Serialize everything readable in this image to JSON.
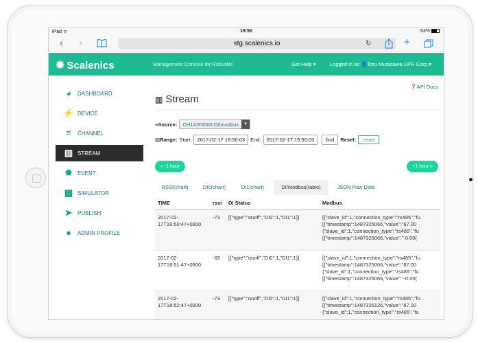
{
  "status_bar": {
    "carrier": "iPad ᯤ",
    "time": "19:50",
    "battery": "63%"
  },
  "browser": {
    "url": "stg.scalenics.io",
    "reload_icon": "reload-icon"
  },
  "header": {
    "logo": "Scalenics",
    "console_title": "Management Console for Robustel",
    "help": "Get Help ▾",
    "logged_in": "Logged in as:👤Toru Murasawa UPR Corp.▾"
  },
  "sidebar": {
    "items": [
      {
        "label": "DASHBOARD",
        "icon": "dashboard-icon",
        "glyph": "◕"
      },
      {
        "label": "DEVICE",
        "icon": "plug-icon",
        "glyph": "⚡"
      },
      {
        "label": "CHANNEL",
        "icon": "database-icon",
        "glyph": "≡"
      },
      {
        "label": "STREAM",
        "icon": "bar-chart-icon",
        "glyph": "▥",
        "active": true
      },
      {
        "label": "EVENT",
        "icon": "gear-icon",
        "glyph": "✹"
      },
      {
        "label": "SIMULATOR",
        "icon": "calculator-icon",
        "glyph": "▦"
      },
      {
        "label": "PUBLISH",
        "icon": "paper-plane-icon",
        "glyph": "➤"
      },
      {
        "label": "ADMIN PROFILE",
        "icon": "user-icon",
        "glyph": "●"
      }
    ]
  },
  "main": {
    "api_docs": "❓API Docs",
    "title": "Stream",
    "source_label": "Source:",
    "source_value": "CH14:R3000 DI/modbus",
    "range_label": "Range:",
    "start_label": "Start:",
    "start_value": "2017-02-17 18:50:03",
    "end_label": "End:",
    "end_value": "2017-02-17 19:50:03",
    "find_label": "find",
    "reset_label": "Reset:",
    "reset_button": "reset",
    "prev_hour": "« -1 hour",
    "next_hour": "+1 hour »",
    "tabs": [
      "RSSI(chart)",
      "DI0(chart)",
      "DI1(chart)",
      "DI/Modbus(table)",
      "JSON Raw Data"
    ],
    "active_tab": 3
  },
  "table": {
    "headers": [
      "TIME",
      "rssi",
      "DI Status",
      "Modbus"
    ],
    "rows": [
      {
        "time": "2017-02-17T18:50:47+0900",
        "rssi": "-73",
        "di": "[{\"type\":\"onoff\",\"DI0\":1,\"DI1\":1}]",
        "modbus": [
          "[{\"slave_id\":1,\"connection_type\":\"rs485\",\"fu",
          "[{\"timestamp\":1487325066,\"value\":\"87.00",
          "{\"slave_id\":1,\"connection_type\":\"rs485\",\"fu",
          "[{\"timestamp\":1487325066,\"value\":\"-0.00("
        ]
      },
      {
        "time": "2017-02-17T18:51:47+0900",
        "rssi": "-69",
        "di": "[{\"type\":\"onoff\",\"DI0\":1,\"DI1\":1}]",
        "modbus": [
          "[{\"slave_id\":1,\"connection_type\":\"rs485\",\"fu",
          "[{\"timestamp\":1487325066,\"value\":\"87.00",
          "{\"slave_id\":1,\"connection_type\":\"rs485\",\"fu",
          "[{\"timestamp\":1487325066,\"value\":\"-0.00("
        ]
      },
      {
        "time": "2017-02-17T18:52:47+0900",
        "rssi": "-73",
        "di": "[{\"type\":\"onoff\",\"DI0\":1,\"DI1\":1}]",
        "modbus": [
          "[{\"slave_id\":1,\"connection_type\":\"rs485\",\"fu",
          "[{\"timestamp\":1487325126,\"value\":\"87.00",
          "{\"slave_id\":1,\"connection_type\":\"rs485\",\"fu"
        ]
      }
    ]
  },
  "colors": {
    "brand": "#1fba94",
    "pill": "#1fd39e",
    "link": "#1d6f86",
    "active_nav": "#2c2c2c"
  }
}
